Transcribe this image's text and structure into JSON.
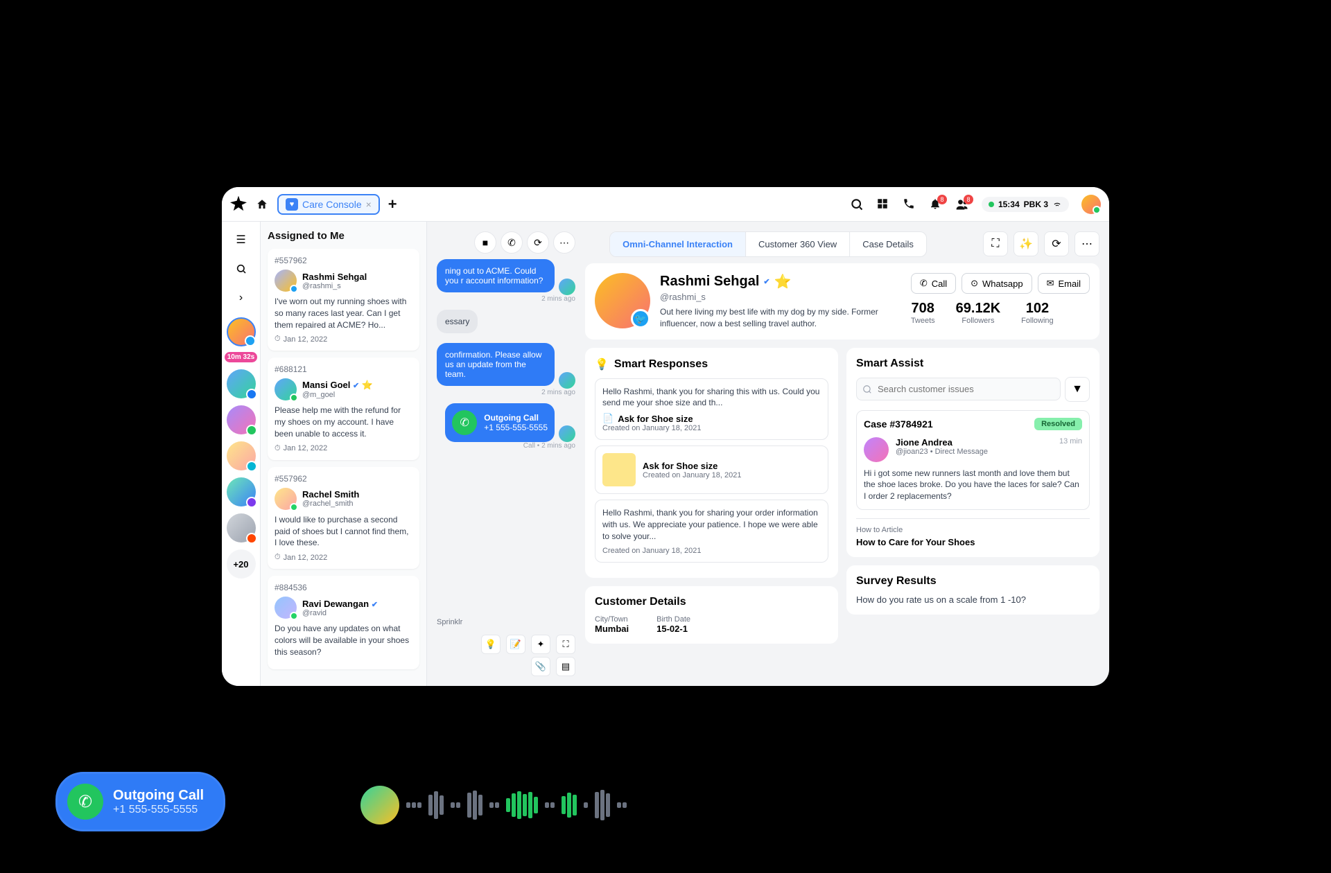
{
  "header": {
    "tab_label": "Care Console",
    "time": "15:34",
    "status": "PBK 3",
    "notif_badge": "8",
    "people_badge": "8"
  },
  "rail": {
    "timer": "10m 32s",
    "more": "+20"
  },
  "assigned": {
    "title": "Assigned to Me",
    "cases": [
      {
        "id": "#557962",
        "name": "Rashmi Sehgal",
        "handle": "@rashmi_s",
        "text": "I've worn out my running shoes with so many races last year. Can I get them repaired at ACME? Ho...",
        "date": "Jan 12, 2022"
      },
      {
        "id": "#688121",
        "name": "Mansi Goel",
        "handle": "@m_goel",
        "text": "Please help me with the refund for my shoes on my account. I have been unable to access it.",
        "date": "Jan 12, 2022"
      },
      {
        "id": "#557962",
        "name": "Rachel Smith",
        "handle": "@rachel_smith",
        "text": "I would like to purchase a second paid of shoes but I cannot find them, I love these.",
        "date": "Jan 12, 2022"
      },
      {
        "id": "#884536",
        "name": "Ravi Dewangan",
        "handle": "@ravid",
        "text": "Do you have any updates on what colors will be available in your shoes this season?",
        "date": ""
      }
    ]
  },
  "tabs": {
    "t1": "Omni-Channel Interaction",
    "t2": "Customer 360 View",
    "t3": "Case Details"
  },
  "chat": {
    "m1": "ning out to ACME. Could you r account information?",
    "m1_time": "2 mins ago",
    "m2": "essary",
    "m3": "confirmation. Please allow us an update from the team.",
    "m3_time": "2 mins ago",
    "call_title": "Outgoing Call",
    "call_num": "+1 555-555-5555",
    "call_meta": "Call • 2 mins ago",
    "footer": "Sprinklr"
  },
  "profile": {
    "name": "Rashmi Sehgal",
    "handle": "@rashmi_s",
    "bio": "Out here living my best life with my dog by my side. Former influencer, now a best selling travel author.",
    "btn_call": "Call",
    "btn_wa": "Whatsapp",
    "btn_email": "Email",
    "tweets": "708",
    "tweets_l": "Tweets",
    "followers": "69.12K",
    "followers_l": "Followers",
    "following": "102",
    "following_l": "Following"
  },
  "smart_responses": {
    "title": "Smart Responses",
    "r1_text": "Hello Rashmi, thank you for sharing this with us. Could you send me your shoe size and th...",
    "r1_title": "Ask for Shoe size",
    "r1_meta": "Created on January 18, 2021",
    "r2_title": "Ask for Shoe size",
    "r2_meta": "Created on January 18, 2021",
    "r3_text": "Hello Rashmi, thank you for sharing your order information with us. We appreciate your patience. I hope we were able to solve your...",
    "r3_meta": "Created on January 18, 2021"
  },
  "smart_assist": {
    "title": "Smart Assist",
    "search_ph": "Search customer issues",
    "case_id": "Case #3784921",
    "resolved": "Resolved",
    "user": "Jione Andrea",
    "handle": "@jioan23 • Direct Message",
    "time": "13 min",
    "msg": "Hi i got some new runners last month and love them but the shoe laces broke. Do you have the laces for sale? Can I order 2 replacements?",
    "article_lbl": "How to Article",
    "article": "How to Care for Your Shoes"
  },
  "customer_details": {
    "title": "Customer Details",
    "city_l": "City/Town",
    "city": "Mumbai",
    "birth_l": "Birth Date",
    "birth": "15-02-1"
  },
  "survey": {
    "title": "Survey Results",
    "q": "How do you rate us on a scale from 1 -10?"
  },
  "floating": {
    "title": "Outgoing Call",
    "num": "+1 555-555-5555"
  }
}
